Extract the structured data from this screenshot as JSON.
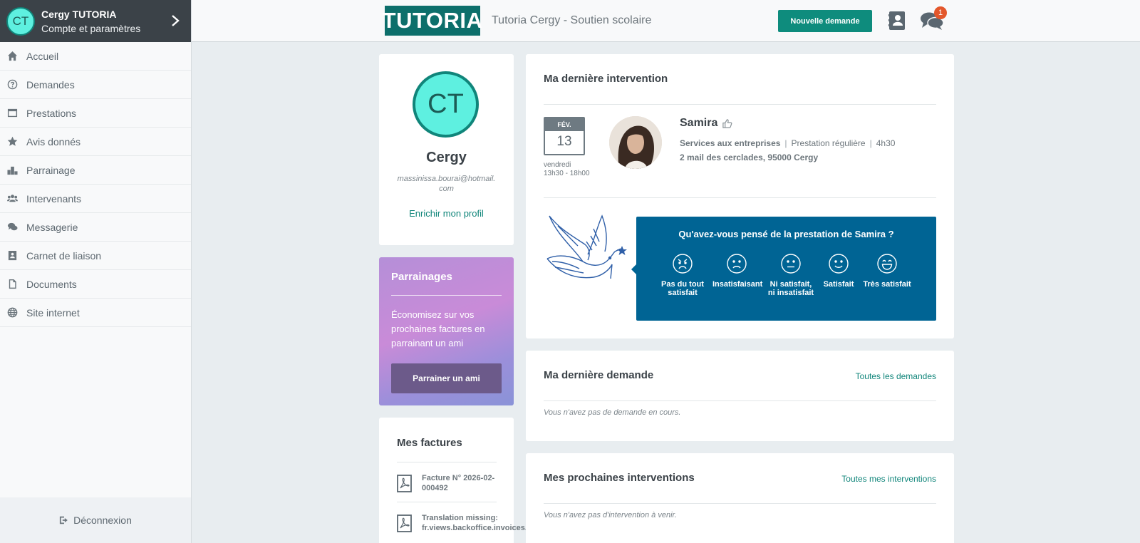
{
  "account": {
    "initials": "CT",
    "name": "Cergy TUTORIA",
    "subtitle": "Compte et paramètres"
  },
  "nav": [
    {
      "label": "Accueil",
      "icon": "home-icon"
    },
    {
      "label": "Demandes",
      "icon": "question-circle-icon"
    },
    {
      "label": "Prestations",
      "icon": "window-icon"
    },
    {
      "label": "Avis donnés",
      "icon": "star-icon"
    },
    {
      "label": "Parrainage",
      "icon": "podium-icon"
    },
    {
      "label": "Intervenants",
      "icon": "users-icon"
    },
    {
      "label": "Messagerie",
      "icon": "chat-icon"
    },
    {
      "label": "Carnet de liaison",
      "icon": "contact-book-icon"
    },
    {
      "label": "Documents",
      "icon": "file-icon"
    },
    {
      "label": "Site internet",
      "icon": "globe-icon"
    }
  ],
  "logout": "Déconnexion",
  "header": {
    "logo": "TUTORIA",
    "site_title": "Tutoria Cergy - Soutien scolaire",
    "new_request": "Nouvelle demande",
    "chat_badge": "1"
  },
  "profile": {
    "initials": "CT",
    "name": "Cergy",
    "email": "massinissa.bourai@hotmail.com",
    "enrich": "Enrichir mon profil"
  },
  "referral": {
    "title": "Parrainages",
    "text": "Économisez sur vos prochaines factures en parrainant un ami",
    "button": "Parrainer un ami"
  },
  "invoices": {
    "title": "Mes factures",
    "items": [
      {
        "label": "Facture N° 2026-02-000492"
      },
      {
        "label": "Translation missing: fr.views.backoffice.invoices."
      }
    ]
  },
  "last_intervention": {
    "title": "Ma dernière intervention",
    "month": "FÉV.",
    "day": "13",
    "weekday": "vendredi",
    "time": "13h30 - 18h00",
    "person": "Samira",
    "service": "Services aux entreprises",
    "frequency": "Prestation régulière",
    "duration": "4h30",
    "address": "2 mail des cerclades, 95000 Cergy",
    "question": "Qu'avez-vous pensé de la prestation de Samira ?",
    "ratings": [
      {
        "label": "Pas du tout satisfait",
        "icon": "angry-face-icon"
      },
      {
        "label": "Insatisfaisant",
        "icon": "sad-face-icon"
      },
      {
        "label": "Ni satisfait, ni insatisfait",
        "icon": "neutral-face-icon"
      },
      {
        "label": "Satisfait",
        "icon": "smile-face-icon"
      },
      {
        "label": "Très satisfait",
        "icon": "grin-face-icon"
      }
    ]
  },
  "last_request": {
    "title": "Ma dernière demande",
    "link": "Toutes les demandes",
    "empty": "Vous n'avez pas de demande en cours."
  },
  "next_interventions": {
    "title": "Mes prochaines interventions",
    "link": "Toutes mes interventions",
    "empty": "Vous n'avez pas d'intervention à venir."
  },
  "colors": {
    "brand": "#0d6f6b",
    "accent": "#0e8c7d",
    "feedback_bg": "#006494",
    "sidebar_dark": "#3b4248",
    "badge": "#e3572b"
  }
}
